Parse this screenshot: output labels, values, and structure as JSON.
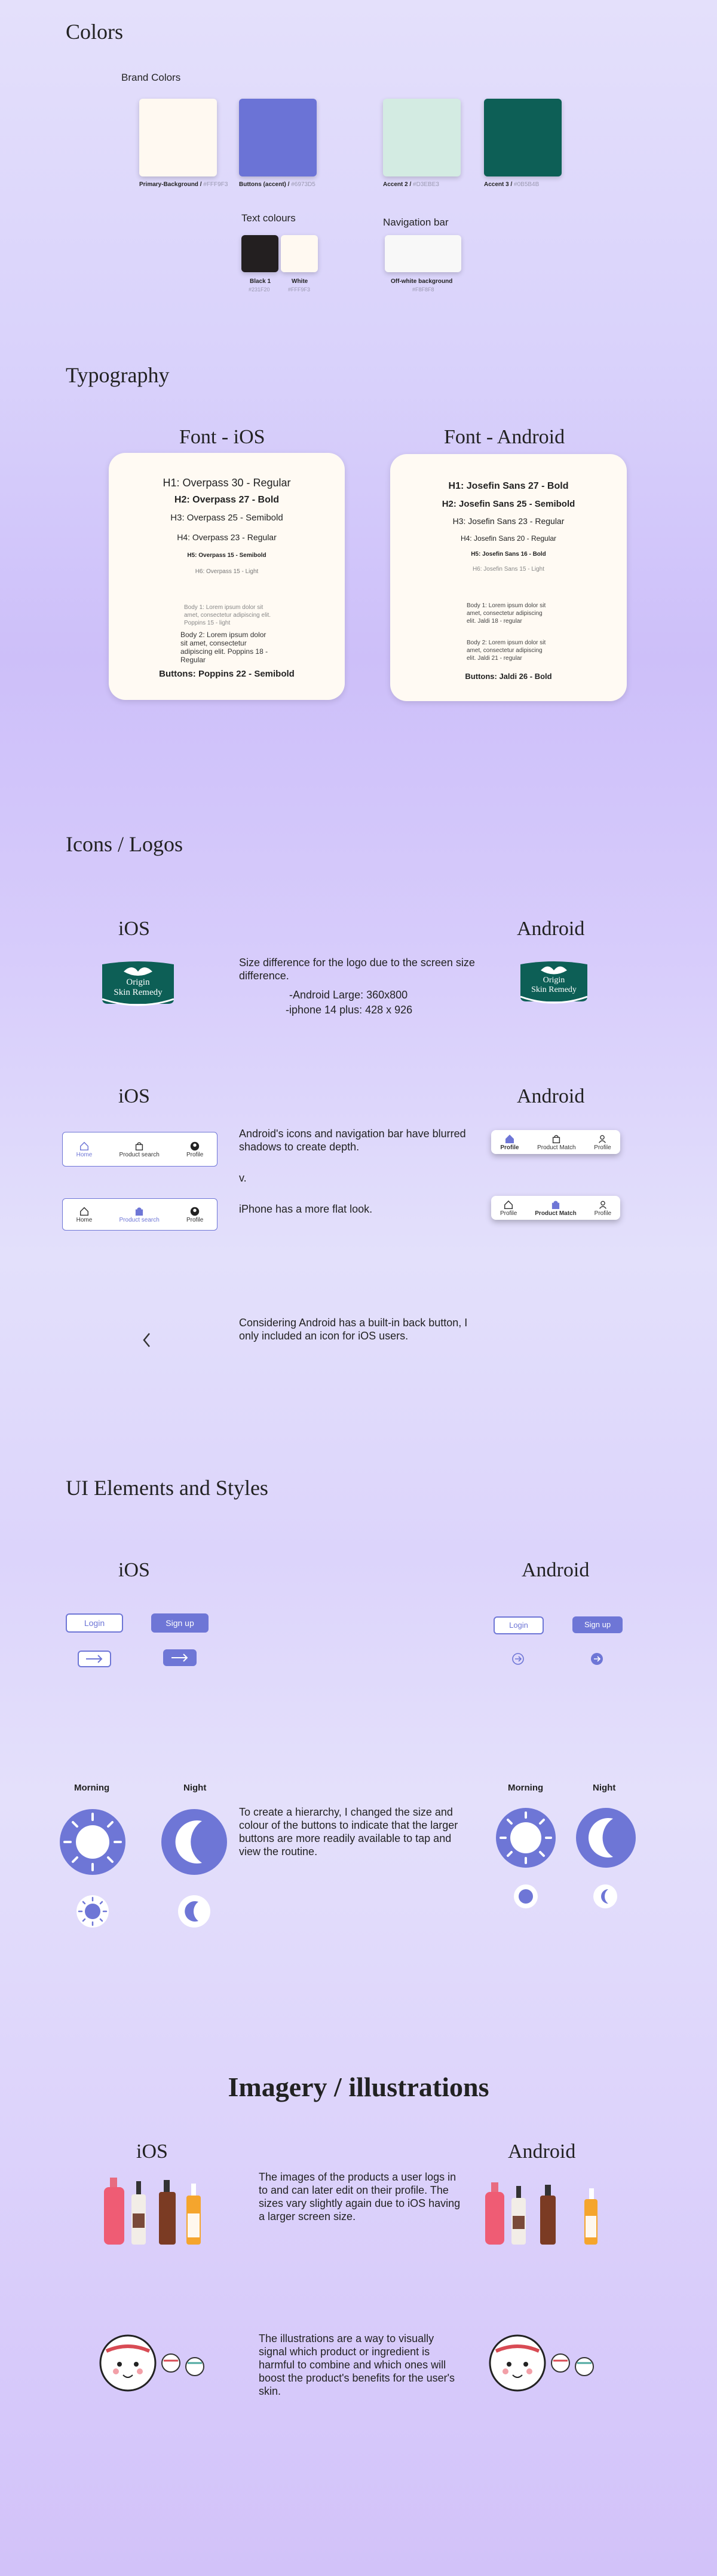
{
  "colors": {
    "title": "Colors",
    "brand_title": "Brand Colors",
    "text_title": "Text colours",
    "nav_title": "Navigation bar",
    "swatches": [
      {
        "name": "Primary-Background",
        "hex": "#FFF9F3",
        "color": "#fff9f1"
      },
      {
        "name": "Buttons (accent)",
        "hex": "#6973D5",
        "color": "#6b73d6"
      },
      {
        "name": "Accent 2",
        "hex": "#D3EBE3",
        "color": "#d3ebe2"
      },
      {
        "name": "Accent 3",
        "hex": "#0B5B4B",
        "color": "#0d5f56"
      }
    ],
    "text_swatches": [
      {
        "name": "Black 1",
        "hex": "#231F20",
        "color": "#231f20"
      },
      {
        "name": "White",
        "hex": "#FFF9F3",
        "color": "#fff9f1"
      }
    ],
    "nav_swatch": {
      "name": "Off-white background",
      "hex": "#F8F8F8",
      "color": "#f8f8f8"
    }
  },
  "typography": {
    "title": "Typography",
    "ios": {
      "heading": "Font - iOS",
      "h1": "H1: Overpass 30 - Regular",
      "h2": "H2: Overpass 27 - Bold",
      "h3": "H3: Overpass 25 - Semibold",
      "h4": "H4: Overpass 23 - Regular",
      "h5": "H5: Overpass 15 - Semibold",
      "h6": "H6: Overpass 15 - Light",
      "body1": "Body 1: Lorem ipsum dolor sit amet, consectetur adipiscing elit. Poppins 15 - light",
      "body2": "Body 2: Lorem ipsum dolor sit amet, consectetur adipiscing elit. Poppins 18 - Regular",
      "buttons": "Buttons: Poppins 22 - Semibold"
    },
    "android": {
      "heading": "Font - Android",
      "h1": "H1: Josefin Sans 27 - Bold",
      "h2": "H2: Josefin Sans 25 - Semibold",
      "h3": "H3: Josefin Sans 23 - Regular",
      "h4": "H4: Josefin Sans 20 - Regular",
      "h5": "H5: Josefin Sans 16 - Bold",
      "h6": "H6: Josefin Sans 15 - Light",
      "body1": "Body 1: Lorem ipsum dolor sit amet, consectetur adipiscing elit. Jaldi 18 - regular",
      "body2": "Body 2: Lorem ipsum dolor sit amet, consectetur adipiscing elit. Jaldi 21 - regular",
      "buttons": "Buttons: Jaldi 26 - Bold"
    }
  },
  "icons": {
    "title": "Icons / Logos",
    "ios_label": "iOS",
    "android_label": "Android",
    "logo_text_1": "Origin",
    "logo_text_2": "Skin Remedy",
    "logo_desc": "Size difference for the logo due to the screen size difference.",
    "logo_android_size": "-Android Large: 360x800",
    "logo_iphone_size": "-iphone 14 plus: 428 x 926",
    "nav_desc_1": "Android's icons and navigation bar have blurred shadows to create depth.",
    "nav_v": "v.",
    "nav_desc_2": "iPhone has a more flat look.",
    "ios_nav": {
      "home": "Home",
      "product_search": "Product search",
      "profile": "Profile"
    },
    "android_nav": {
      "profile": "Profile",
      "product_match": "Product Match",
      "profile2": "Profile"
    },
    "back_desc": "Considering Android has a built-in back button, I only included an icon for iOS users.",
    "back_icon": "chevron-left-icon"
  },
  "ui": {
    "title": "UI Elements and Styles",
    "ios_label": "iOS",
    "android_label": "Android",
    "login": "Login",
    "signup": "Sign up",
    "morning": "Morning",
    "night": "Night",
    "desc": "To create a hierarchy, I changed the size and colour of the buttons to indicate that the larger buttons are more readily available to tap and view the routine."
  },
  "imagery": {
    "title": "Imagery / illustrations",
    "ios_label": "iOS",
    "android_label": "Android",
    "products_desc": "The images of the products a user logs in to and can later edit on their profile. The sizes vary slightly again due to iOS having a larger screen size.",
    "illus_desc": "The illustrations are a way to visually signal which product or ingredient is harmful to combine and which ones will boost the product's benefits for the user's skin."
  }
}
